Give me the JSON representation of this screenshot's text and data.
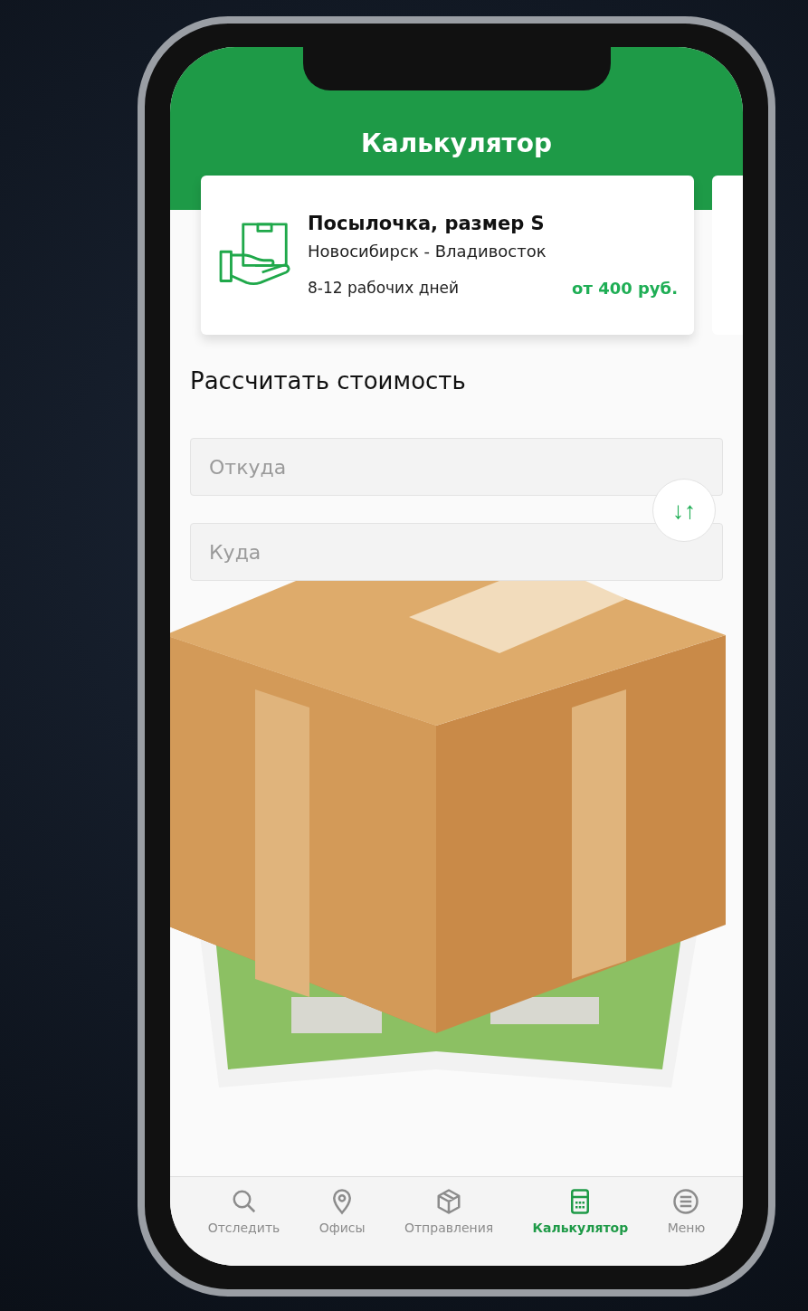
{
  "header": {
    "title": "Калькулятор"
  },
  "tariff_card": {
    "title": "Посылочка, размер S",
    "route": "Новосибирск - Владивосток",
    "duration": "8-12 рабочих дней",
    "price": "от 400 руб."
  },
  "calculator": {
    "heading": "Рассчитать стоимость",
    "fields": [
      {
        "placeholder": "Откуда"
      },
      {
        "placeholder": "Куда"
      }
    ],
    "swap_button": "↓↑"
  },
  "tab_bar": [
    {
      "label": "Отследить",
      "selected": false
    },
    {
      "label": "Офисы",
      "selected": false
    },
    {
      "label": "Отправления",
      "selected": false
    },
    {
      "label": "Калькулятор",
      "selected": true
    },
    {
      "label": "Меню",
      "selected": false
    }
  ]
}
